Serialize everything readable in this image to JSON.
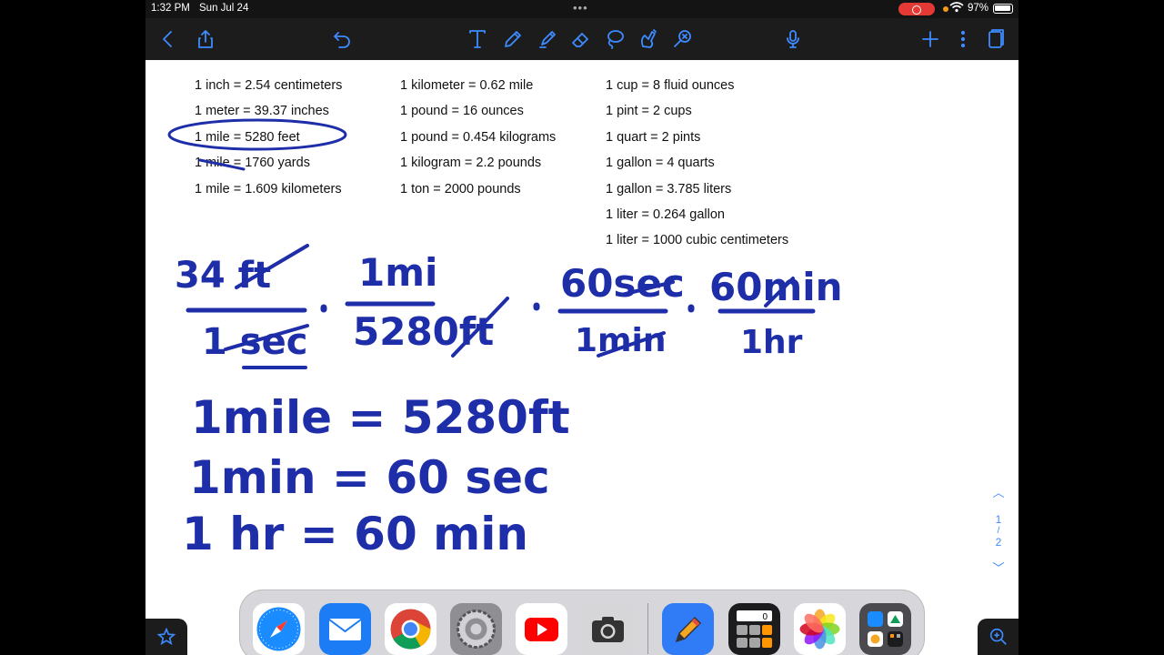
{
  "status_bar": {
    "time": "1:32 PM",
    "date": "Sun Jul 24",
    "battery": "97%"
  },
  "toolbar": {
    "left": [
      "back-icon",
      "share-icon",
      "undo-icon"
    ],
    "tools": [
      "text-tool-icon",
      "pen-tool-icon",
      "highlighter-tool-icon",
      "eraser-tool-icon",
      "lasso-tool-icon",
      "elements-tool-icon",
      "laser-pointer-icon"
    ],
    "right": [
      "microphone-icon",
      "add-icon",
      "more-icon",
      "pages-icon"
    ]
  },
  "conversions": {
    "col1": [
      "1 inch = 2.54 centimeters",
      "1 meter = 39.37 inches",
      "1 mile = 5280 feet",
      "1 mile = 1760 yards",
      "1 mile = 1.609 kilometers"
    ],
    "col2": [
      "1 kilometer = 0.62 mile",
      "1 pound = 16 ounces",
      "1 pound = 0.454 kilograms",
      "1 kilogram = 2.2 pounds",
      "1 ton = 2000 pounds"
    ],
    "col3": [
      "1 cup = 8 fluid ounces",
      "1 pint = 2 cups",
      "1 quart = 2 pints",
      "1 gallon = 4 quarts",
      "1 gallon = 3.785 liters",
      "1 liter = 0.264 gallon",
      "1 liter = 1000 cubic centimeters"
    ]
  },
  "handwriting": {
    "f1_num": "34 ft",
    "f1_den": "1 sec",
    "f2_num": "1mi",
    "f2_den": "5280ft",
    "f3_num": "60sec",
    "f3_den": "1min",
    "f4_num": "60min",
    "f4_den": "1hr",
    "eq1": "1mile = 5280ft",
    "eq2": "1min = 60 sec",
    "eq3": "1 hr = 60 min"
  },
  "page_nav": {
    "current": "1",
    "sep": "/",
    "total": "2"
  },
  "dock": {
    "apps": [
      "safari-app-icon",
      "mail-app-icon",
      "chrome-app-icon",
      "settings-app-icon",
      "youtube-app-icon",
      "camera-app-icon",
      "goodnotes-app-icon",
      "calculator-app-icon",
      "photos-app-icon",
      "app-folder-icon"
    ],
    "calculator_display": "0"
  },
  "colors": {
    "accent": "#3d8bff",
    "ink": "#1e2da8",
    "toolbar": "#1c1c1c"
  }
}
